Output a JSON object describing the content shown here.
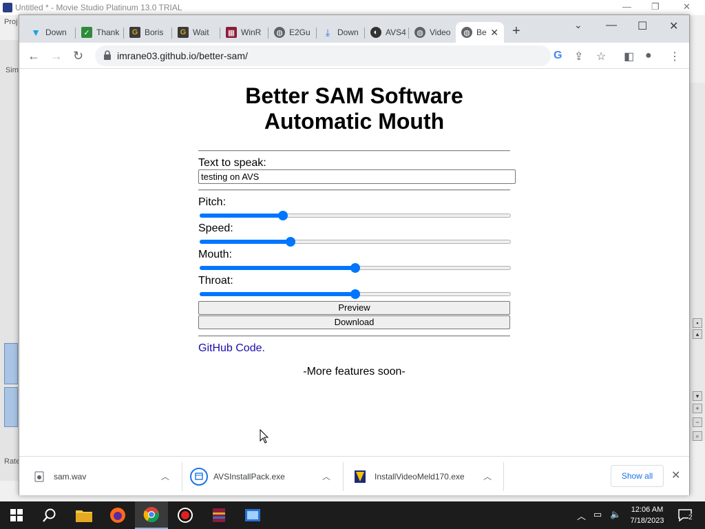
{
  "background_app": {
    "title": "Untitled * - Movie Studio Platinum 13.0 TRIAL",
    "menu_fragment": "Proj",
    "side_label_1": "Sim",
    "side_label_2": "Rate"
  },
  "browser": {
    "tabs": [
      {
        "label": "Down",
        "icon": "download-arrow-icon",
        "color": "#1aa1e6"
      },
      {
        "label": "Thank",
        "icon": "checkmark-favicon",
        "color": "#2e8b3c"
      },
      {
        "label": "Boris",
        "icon": "g-favicon",
        "color": "#d4a017"
      },
      {
        "label": "Wait",
        "icon": "g-favicon",
        "color": "#d4a017"
      },
      {
        "label": "WinR",
        "icon": "winrar-favicon",
        "color": "#8a1d3a"
      },
      {
        "label": "E2Gu",
        "icon": "globe-icon",
        "color": "#5f6368"
      },
      {
        "label": "Down",
        "icon": "download-icon",
        "color": "#1a73e8"
      },
      {
        "label": "AVS4",
        "icon": "avs-favicon",
        "color": "#333333"
      },
      {
        "label": "Video",
        "icon": "globe-icon",
        "color": "#5f6368"
      },
      {
        "label": "Be",
        "icon": "globe-icon",
        "color": "#5f6368"
      }
    ],
    "url": "imrane03.github.io/better-sam/"
  },
  "page": {
    "title_line1": "Better SAM Software",
    "title_line2": "Automatic Mouth",
    "text_label": "Text to speak:",
    "text_value": "testing on AVS",
    "sliders": [
      {
        "label": "Pitch:",
        "value": 0.26
      },
      {
        "label": "Speed:",
        "value": 0.285
      },
      {
        "label": "Mouth:",
        "value": 0.5
      },
      {
        "label": "Throat:",
        "value": 0.5
      }
    ],
    "preview_label": "Preview",
    "download_label": "Download",
    "github_link": "GitHub Code.",
    "more_text": "-More features soon-"
  },
  "downloads": {
    "items": [
      {
        "name": "sam.wav"
      },
      {
        "name": "AVSInstallPack.exe"
      },
      {
        "name": "InstallVideoMeld170.exe"
      }
    ],
    "show_all": "Show all"
  },
  "taskbar": {
    "time": "12:06 AM",
    "date": "7/18/2023",
    "notification_count": "2"
  },
  "colors": {
    "slider_accent": "#0075ff",
    "link": "#1a0dab",
    "show_all": "#1a73e8"
  }
}
